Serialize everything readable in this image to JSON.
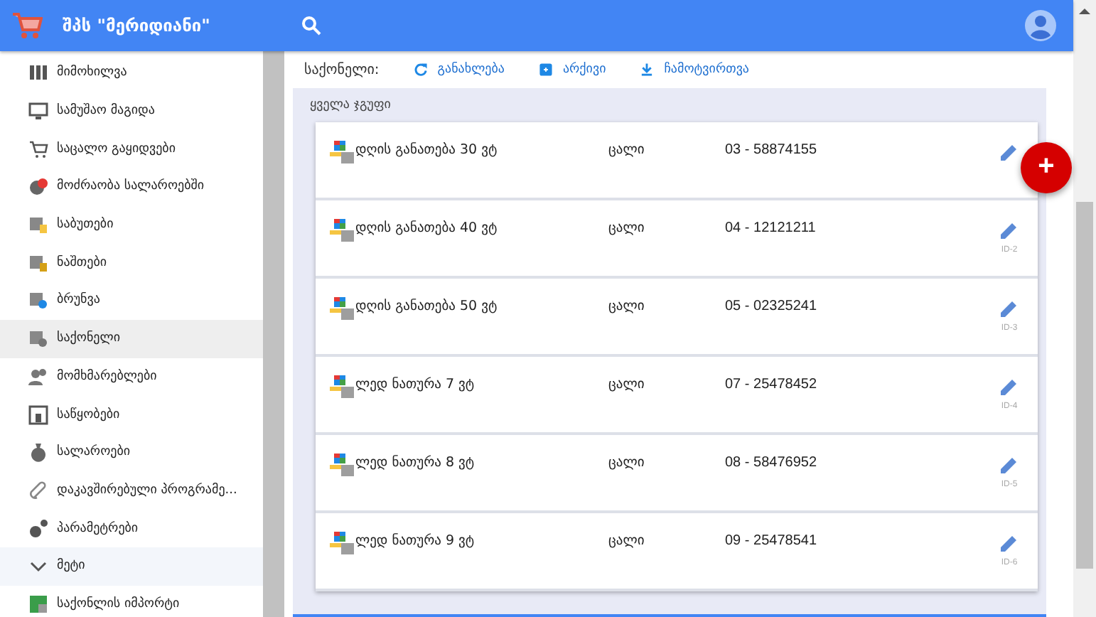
{
  "header": {
    "title": "შპს \"მერიდიანი\""
  },
  "sidebar": {
    "items": [
      {
        "label": "მიმოხილვა",
        "selected": false
      },
      {
        "label": "სამუშაო მაგიდა",
        "selected": false
      },
      {
        "label": "საცალო გაყიდვები",
        "selected": false
      },
      {
        "label": "მოძრაობა სალაროებში",
        "selected": false
      },
      {
        "label": "საბუთები",
        "selected": false
      },
      {
        "label": "ნაშთები",
        "selected": false
      },
      {
        "label": "ბრუნვა",
        "selected": false
      },
      {
        "label": "საქონელი",
        "selected": true
      },
      {
        "label": "მომხმარებლები",
        "selected": false
      },
      {
        "label": "საწყობები",
        "selected": false
      },
      {
        "label": "სალაროები",
        "selected": false
      },
      {
        "label": "დაკავშირებული პროგრამე...",
        "selected": false
      },
      {
        "label": "პარამეტრები",
        "selected": false
      },
      {
        "label": "მეტი",
        "kind": "group",
        "expanded": true,
        "selected": false
      },
      {
        "label": "საქონლის იმპორტი",
        "selected": false
      }
    ]
  },
  "toolbar": {
    "title": "საქონელი:",
    "actions": [
      {
        "label": "განახლება",
        "kind": "refresh"
      },
      {
        "label": "არქივი",
        "kind": "archive"
      },
      {
        "label": "ჩამოტვირთვა",
        "kind": "download"
      }
    ]
  },
  "list": {
    "group": "ყველა ჯგუფი",
    "rows": [
      {
        "name": "დღის განათება 30 ვტ",
        "unit": "ცალი",
        "code": "03 - 58874155"
      },
      {
        "name": "დღის განათება 40 ვტ",
        "unit": "ცალი",
        "code": "04 - 12121211",
        "id": "ID-2"
      },
      {
        "name": "დღის განათება 50 ვტ",
        "unit": "ცალი",
        "code": "05 - 02325241",
        "id": "ID-3"
      },
      {
        "name": "ლედ ნათურა 7 ვტ",
        "unit": "ცალი",
        "code": "07 - 25478452",
        "id": "ID-4"
      },
      {
        "name": "ლედ ნათურა 8 ვტ",
        "unit": "ცალი",
        "code": "08 - 58476952",
        "id": "ID-5"
      },
      {
        "name": "ლედ ნათურა 9 ვტ",
        "unit": "ცალი",
        "code": "09 - 25478541",
        "id": "ID-6"
      }
    ],
    "add_button": "+"
  }
}
